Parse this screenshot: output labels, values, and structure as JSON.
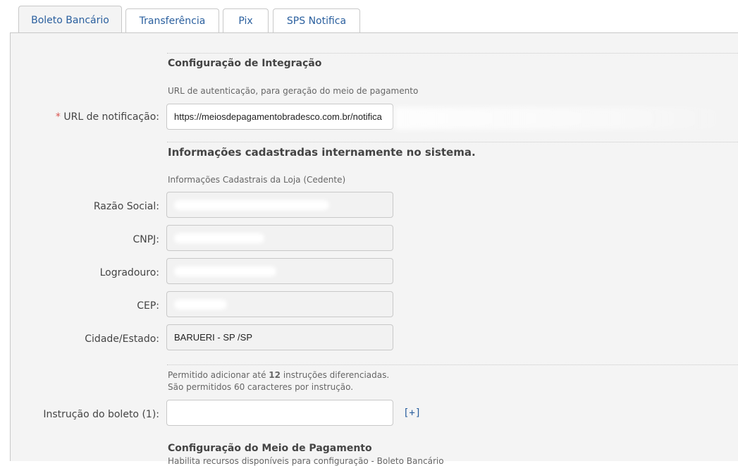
{
  "tabs": [
    {
      "label": "Boleto Bancário",
      "active": true
    },
    {
      "label": "Transferência",
      "active": false
    },
    {
      "label": "Pix",
      "active": false
    },
    {
      "label": "SPS Notifica",
      "active": false
    }
  ],
  "integration": {
    "title": "Configuração de Integração",
    "description": "URL de autenticação, para geração do meio de pagamento",
    "required_mark": "*",
    "url_label": "URL de notificação:",
    "url_value": "https://meiosdepagamentobradesco.com.br/notifica"
  },
  "internal": {
    "title": "Informações cadastradas internamente no sistema.",
    "description": "Informações Cadastrais da Loja (Cedente)",
    "fields": {
      "razao_social_label": "Razão Social:",
      "cnpj_label": "CNPJ:",
      "logradouro_label": "Logradouro:",
      "cep_label": "CEP:",
      "cidade_label": "Cidade/Estado:",
      "cidade_value": "BARUERI - SP /SP"
    }
  },
  "instructions": {
    "line1_prefix": "Permitido adicionar até ",
    "line1_count": "12",
    "line1_suffix": " instruções diferenciadas.",
    "line2": "São permitidos 60 caracteres por instrução.",
    "label": "Instrução do boleto (1):",
    "value": "",
    "add_label": "[+]"
  },
  "payment": {
    "title": "Configuração do Meio de Pagamento",
    "description": "Habilita recursos disponíveis para configuração - Boleto Bancário"
  },
  "colors": {
    "link": "#2a5f9e",
    "required": "#d9534f",
    "panel_bg": "#f4f4f4"
  }
}
